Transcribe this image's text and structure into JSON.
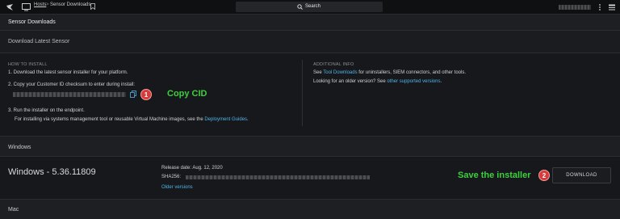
{
  "topbar": {
    "crumb_hosts": "Hosts",
    "crumb_sep": ">",
    "crumb_current": "Sensor Downloads",
    "search_label": "Search"
  },
  "page": {
    "title": "Sensor Downloads",
    "subtitle": "Download Latest Sensor"
  },
  "install": {
    "heading": "HOW TO INSTALL",
    "step1": "1. Download the latest sensor installer for your platform.",
    "step2": "2. Copy your Customer ID checksum to enter during install:",
    "step3": "3. Run the installer on the endpoint.",
    "step3b_prefix": "For installing via systems management tool or reusable Virtual Machine images, see the ",
    "step3b_link": "Deployment Guides",
    "step3b_suffix": "."
  },
  "additional": {
    "heading": "ADDITIONAL INFO",
    "line1_prefix": "See ",
    "line1_link": "Tool Downloads",
    "line1_suffix": " for uninstallers, SIEM connectors, and other tools.",
    "line2_prefix": "Looking for an older version? See ",
    "line2_link": "other supported versions",
    "line2_suffix": "."
  },
  "annotations": {
    "badge1": "1",
    "copy_cid": "Copy CID",
    "badge2": "2",
    "save_installer": "Save the installer"
  },
  "windows": {
    "section": "Windows",
    "version": "Windows - 5.36.11809",
    "release": "Release date: Aug. 12, 2020",
    "sha_label": "SHA256:",
    "older": "Older versions",
    "download": "DOWNLOAD"
  },
  "mac": {
    "section": "Mac"
  },
  "colors": {
    "accent_link": "#4fb3e8",
    "annotation_green": "#3ecf3e",
    "badge_red": "#d63a3a"
  }
}
